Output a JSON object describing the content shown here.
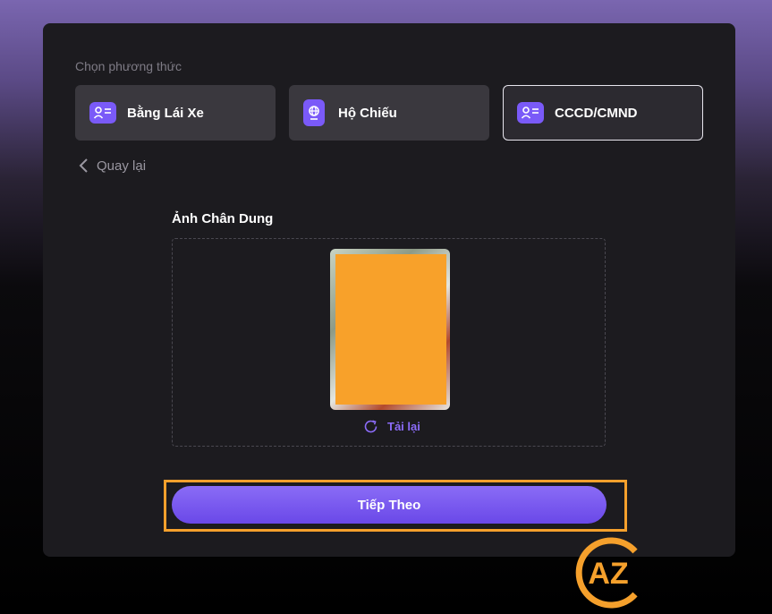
{
  "method_label": "Chọn phương thức",
  "methods": [
    {
      "label": "Bằng Lái Xe",
      "icon": "id-card-icon",
      "selected": false
    },
    {
      "label": "Hộ Chiếu",
      "icon": "passport-icon",
      "selected": false
    },
    {
      "label": "CCCD/CMND",
      "icon": "id-card-icon",
      "selected": true
    }
  ],
  "back_label": "Quay lại",
  "portrait": {
    "title": "Ảnh Chân Dung",
    "reload_label": "Tải lại"
  },
  "next_label": "Tiếp Theo",
  "watermark": "AZ",
  "colors": {
    "accent": "#7a5af8",
    "highlight": "#f5a02c",
    "redact": "#f8a12a",
    "panel": "#1c1b1f"
  }
}
